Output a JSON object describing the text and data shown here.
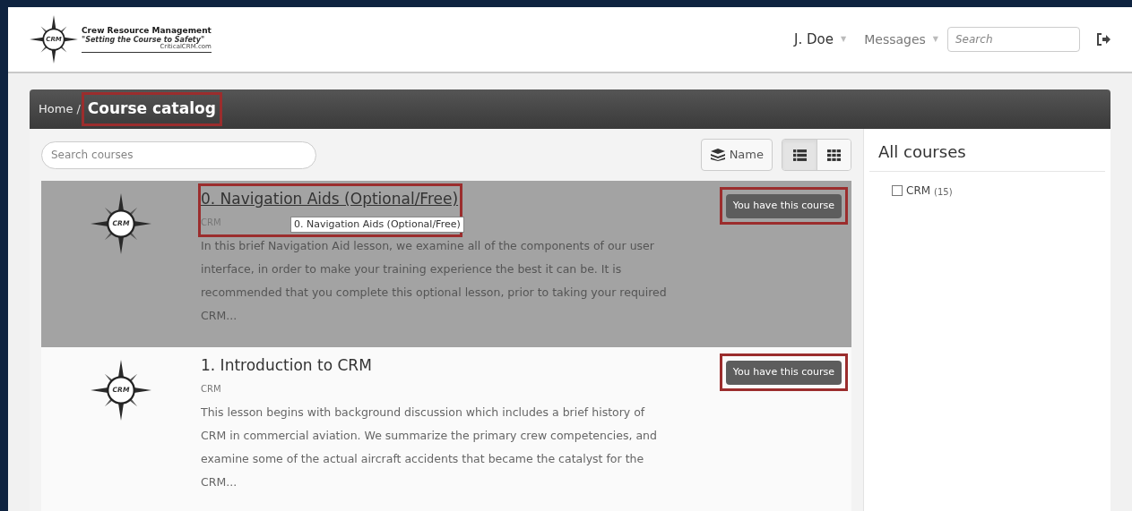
{
  "header": {
    "logo": {
      "title": "Crew Resource Management",
      "tagline": "\"Setting the Course to Safety\"",
      "site": "CriticalCRM.com",
      "mark": "CRM"
    },
    "user_menu": "J. Doe",
    "user_menu_caret": "▼",
    "messages_menu": "Messages",
    "messages_menu_caret": "▼",
    "search": {
      "placeholder": "Search"
    }
  },
  "breadcrumb": [
    {
      "label": "Home",
      "highlighted": false
    },
    {
      "separator": "/",
      "label": "Course catalog",
      "highlighted": true
    }
  ],
  "toolbar": {
    "search": {
      "placeholder": "Search courses"
    },
    "sort_button": "Name",
    "views": [
      {
        "kind": "list",
        "selected": true
      },
      {
        "kind": "grid",
        "selected": false
      }
    ]
  },
  "courses": [
    {
      "title": "0. Navigation Aids (Optional/Free)",
      "category": "CRM",
      "icon_text": "CRM",
      "hovered": true,
      "highlighted": true,
      "tooltip": "0. Navigation Aids  (Optional/Free)",
      "summary": "In this brief Navigation Aid lesson, we examine all of the components of our user interface, in order to make your training experience the best it can be. It is recommended that you complete this optional lesson, prior to taking your required CRM...",
      "status_button": "You have this course",
      "button_highlighted": true
    },
    {
      "title": "1. Introduction to CRM",
      "category": "CRM",
      "icon_text": "CRM",
      "hovered": false,
      "highlighted": false,
      "summary": "This lesson begins with background discussion which includes a brief history of CRM in commercial aviation. We summarize the primary crew competencies, and examine some of the actual aircraft accidents that became the catalyst for the CRM...",
      "status_button": "You have this course",
      "button_highlighted": true
    }
  ],
  "sidebar": {
    "title": "All courses",
    "filters": [
      {
        "label": "CRM",
        "count": "(15)",
        "checked": false
      }
    ]
  }
}
